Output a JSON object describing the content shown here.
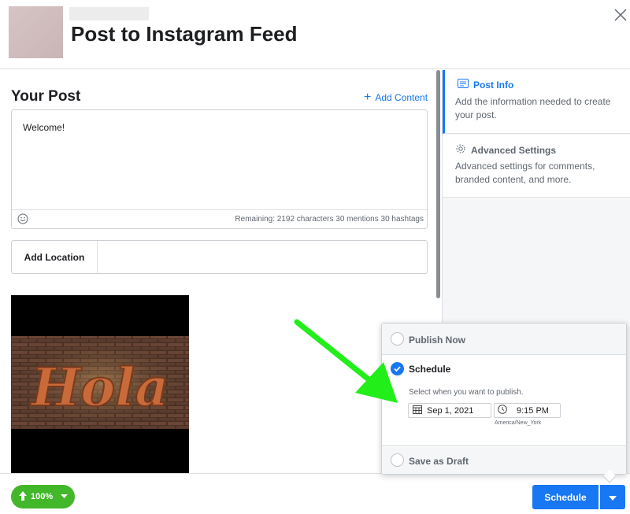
{
  "header": {
    "title": "Post to Instagram Feed",
    "close_icon": "close-icon"
  },
  "post": {
    "section_title": "Your Post",
    "add_content_label": "Add Content",
    "caption_text": "Welcome!",
    "remaining_text": "Remaining: 2192 characters 30 mentions 30 hashtags",
    "add_location_label": "Add Location",
    "image_text": "Hola"
  },
  "sidebar": {
    "items": [
      {
        "title": "Post Info",
        "description": "Add the information needed to create your post.",
        "icon": "post-info-icon",
        "active": true
      },
      {
        "title": "Advanced Settings",
        "description": "Advanced settings for comments, branded content, and more.",
        "icon": "gear-icon",
        "active": false
      }
    ]
  },
  "publish_menu": {
    "options": [
      {
        "label": "Publish Now",
        "selected": false
      },
      {
        "label": "Schedule",
        "selected": true
      },
      {
        "label": "Save as Draft",
        "selected": false
      }
    ],
    "schedule_hint": "Select when you want to publish.",
    "date_value": "Sep 1, 2021",
    "time_value": "9:15 PM",
    "timezone": "America/New_York"
  },
  "footer": {
    "upload_progress": "100%",
    "schedule_label": "Schedule"
  },
  "colors": {
    "accent": "#1877f2",
    "upload_green": "#42b72a",
    "annotation_arrow": "#22ee1a"
  }
}
